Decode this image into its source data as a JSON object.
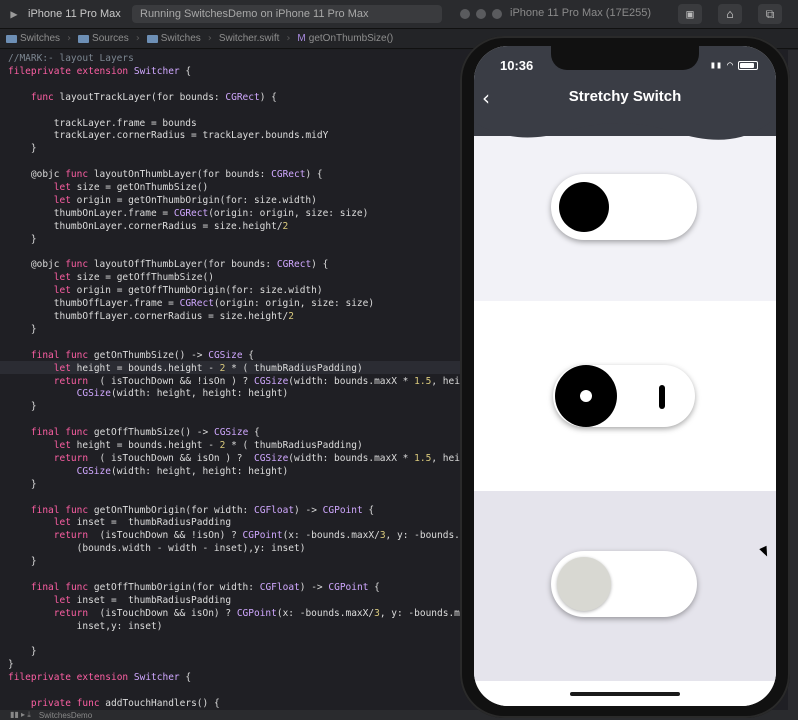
{
  "toolbar": {
    "scheme": "iPhone 11 Pro Max",
    "status": "Running SwitchesDemo on iPhone 11 Pro Max",
    "simulator_title": "iPhone 11 Pro Max (17E255)"
  },
  "jumpbar": {
    "crumbs": [
      "Switches",
      "Sources",
      "Switches",
      "Switcher.swift",
      "getOnThumbSize()"
    ]
  },
  "code_lines": [
    "//MARK:- layout Layers",
    "fileprivate extension Switcher {",
    "",
    "    func layoutTrackLayer(for bounds: CGRect) {",
    "",
    "        trackLayer.frame = bounds",
    "        trackLayer.cornerRadius = trackLayer.bounds.midY",
    "    }",
    "",
    "    @objc func layoutOnThumbLayer(for bounds: CGRect) {",
    "        let size = getOnThumbSize()",
    "        let origin = getOnThumbOrigin(for: size.width)",
    "        thumbOnLayer.frame = CGRect(origin: origin, size: size)",
    "        thumbOnLayer.cornerRadius = size.height/2",
    "    }",
    "",
    "    @objc func layoutOffThumbLayer(for bounds: CGRect) {",
    "        let size = getOffThumbSize()",
    "        let origin = getOffThumbOrigin(for: size.width)",
    "        thumbOffLayer.frame = CGRect(origin: origin, size: size)",
    "        thumbOffLayer.cornerRadius = size.height/2",
    "    }",
    "",
    "    final func getOnThumbSize() -> CGSize {",
    "        let height = bounds.height - 2 * ( thumbRadiusPadding)",
    "        return  ( isTouchDown && !isOn ) ? CGSize(width: bounds.maxX * 1.5, heig",
    "            CGSize(width: height, height: height)",
    "    }",
    "",
    "    final func getOffThumbSize() -> CGSize {",
    "        let height = bounds.height - 2 * ( thumbRadiusPadding)",
    "        return  ( isTouchDown && isOn ) ?  CGSize(width: bounds.maxX * 1.5, heig",
    "            CGSize(width: height, height: height)",
    "    }",
    "",
    "    final func getOnThumbOrigin(for width: CGFloat) -> CGPoint {",
    "        let inset =  thumbRadiusPadding",
    "        return  (isTouchDown && !isOn) ? CGPoint(x: -bounds.maxX/3, y: -bounds.m",
    "            (bounds.width - width - inset),y: inset)",
    "    }",
    "",
    "    final func getOffThumbOrigin(for width: CGFloat) -> CGPoint {",
    "        let inset =  thumbRadiusPadding",
    "        return  (isTouchDown && isOn) ? CGPoint(x: -bounds.maxX/3, y: -bounds.mi",
    "            inset,y: inset)",
    "",
    "    }",
    "}",
    "fileprivate extension Switcher {",
    "",
    "    private func addTouchHandlers() {"
  ],
  "phone": {
    "time": "10:36",
    "back_icon": "chevron-left-icon",
    "title": "Stretchy Switch",
    "nav_color": "#3a3d45",
    "switches": [
      {
        "state": "on",
        "thumb_color": "#000000"
      },
      {
        "state": "on-with-indicator",
        "thumb_color": "#000000"
      },
      {
        "state": "off",
        "thumb_color": "#d8d8d2"
      }
    ]
  },
  "bottombar": {
    "label": "SwitchesDemo"
  }
}
